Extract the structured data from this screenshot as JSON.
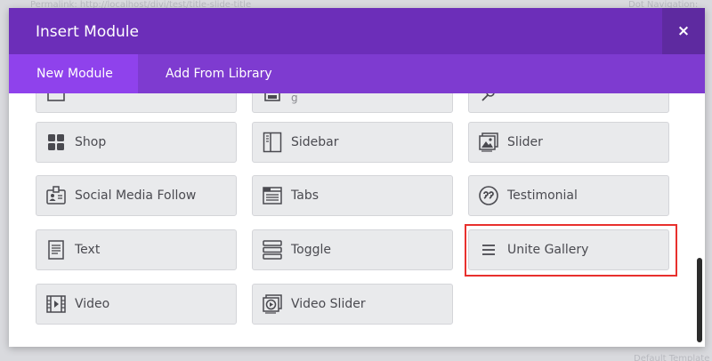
{
  "background": {
    "left_text": "Permalink: http://localhost/divi/test/title-slide-title",
    "right_text": "Dot Navigation:",
    "bottom_text": "Default Template"
  },
  "modal": {
    "title": "Insert Module",
    "close_label": "×",
    "tabs": [
      {
        "label": "New Module",
        "active": true
      },
      {
        "label": "Add From Library",
        "active": false
      }
    ]
  },
  "modules": [
    {
      "label": "",
      "icon": "partial-module-icon"
    },
    {
      "label": "",
      "icon": "post-slider-icon"
    },
    {
      "label": "",
      "icon": "search-icon"
    },
    {
      "label": "Shop",
      "icon": "grid-squares-icon"
    },
    {
      "label": "Sidebar",
      "icon": "sidebar-icon"
    },
    {
      "label": "Slider",
      "icon": "image-slider-icon"
    },
    {
      "label": "Social Media Follow",
      "icon": "id-badge-icon"
    },
    {
      "label": "Tabs",
      "icon": "tabs-icon"
    },
    {
      "label": "Testimonial",
      "icon": "quote-icon"
    },
    {
      "label": "Text",
      "icon": "text-document-icon"
    },
    {
      "label": "Toggle",
      "icon": "toggle-icon"
    },
    {
      "label": "Unite Gallery",
      "icon": "hamburger-menu-icon"
    },
    {
      "label": "Video",
      "icon": "video-film-icon"
    },
    {
      "label": "Video Slider",
      "icon": "video-slider-icon"
    }
  ],
  "colors": {
    "header": "#6c2eb9",
    "tabs_bar": "#7e3bd0",
    "active_tab": "#8f42ec",
    "highlight": "#e8302d",
    "card_bg": "#e9eaec"
  }
}
